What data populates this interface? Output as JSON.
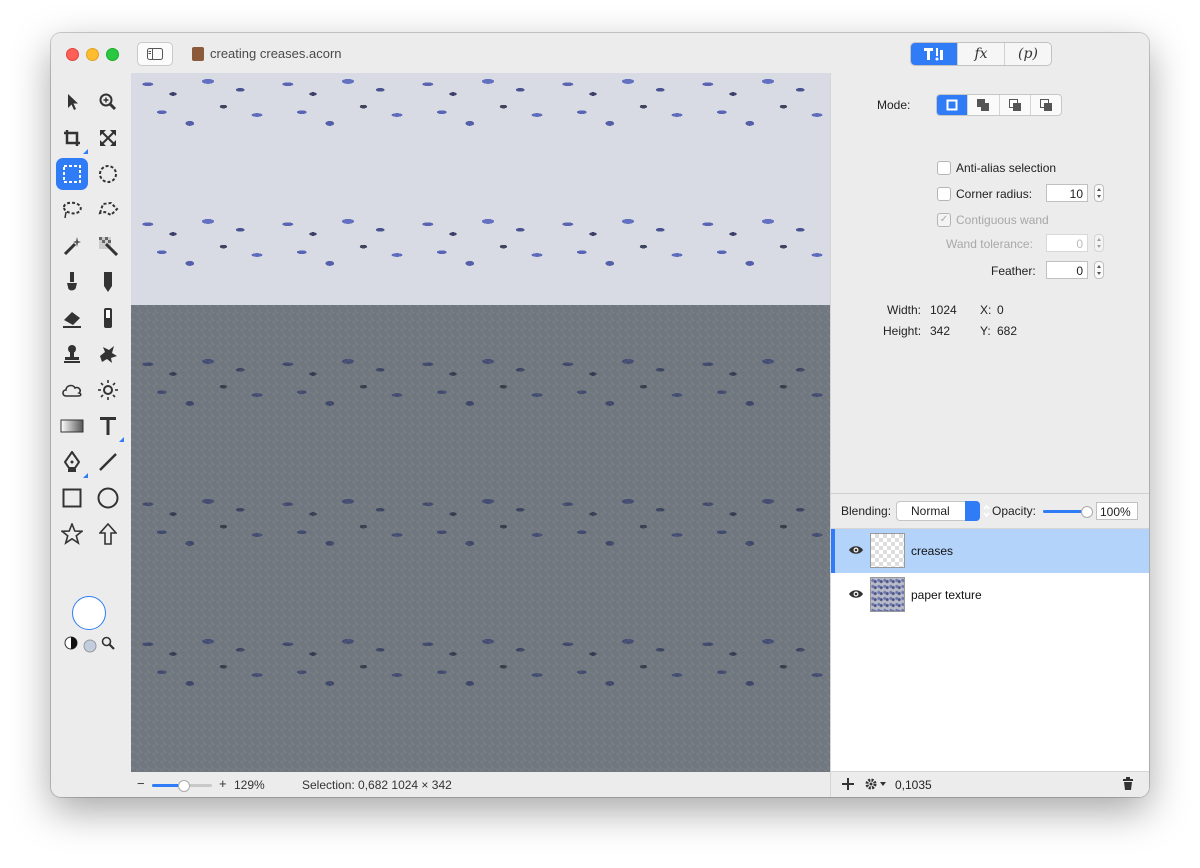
{
  "window": {
    "title": "creating creases.acorn"
  },
  "toolbar": {
    "inspector_tabs": [
      "T!",
      "fx",
      "(p)"
    ]
  },
  "tools": [
    "select-arrow-icon",
    "zoom-in-icon",
    "crop-icon",
    "transform-icon",
    "rect-marquee-icon",
    "ellipse-marquee-icon",
    "lasso-icon",
    "polygon-lasso-icon",
    "magic-wand-icon",
    "color-wand-icon",
    "brush-icon",
    "pencil-icon",
    "eraser-icon",
    "fill-icon",
    "clone-stamp-icon",
    "smudge-icon",
    "cloud-icon",
    "sun-icon",
    "gradient-icon",
    "text-icon",
    "pen-icon",
    "line-icon",
    "rectangle-icon",
    "circle-icon",
    "star-icon",
    "arrow-shape-icon"
  ],
  "status": {
    "zoom_minus": "−",
    "zoom_plus": "+",
    "zoom_level": "129%",
    "selection": "Selection: 0,682 1024 × 342"
  },
  "inspector": {
    "mode_label": "Mode:",
    "antialias_label": "Anti-alias selection",
    "corner_radius_label": "Corner radius:",
    "corner_radius_value": "10",
    "contiguous_label": "Contiguous wand",
    "wand_tolerance_label": "Wand tolerance:",
    "wand_tolerance_value": "0",
    "feather_label": "Feather:",
    "feather_value": "0",
    "width_label": "Width:",
    "width_value": "1024",
    "x_label": "X:",
    "x_value": "0",
    "height_label": "Height:",
    "height_value": "342",
    "y_label": "Y:",
    "y_value": "682"
  },
  "layers": {
    "blending_label": "Blending:",
    "blending_value": "Normal",
    "opacity_label": "Opacity:",
    "opacity_value": "100%",
    "opacity_fraction": 1.0,
    "items": [
      {
        "name": "creases"
      },
      {
        "name": "paper texture"
      }
    ],
    "footer_coords": "0,1035"
  },
  "colors": {
    "accent": "#2f7cf6",
    "selected_row": "#b3d3fb"
  }
}
